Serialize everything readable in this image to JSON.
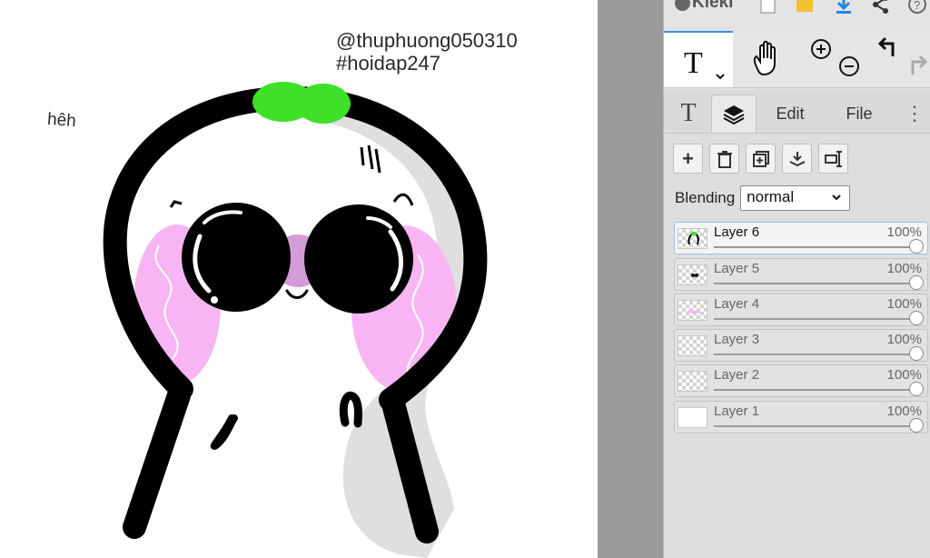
{
  "app": {
    "name": "Kleki"
  },
  "canvas": {
    "text_handle": "@thuphuong050310",
    "text_tag": "#hoidap247",
    "text_left": "hêh"
  },
  "tools": {
    "active_tool": "text-tool",
    "hand_tool": "hand-tool"
  },
  "tabs": [
    {
      "id": "text",
      "label": ""
    },
    {
      "id": "layers",
      "label": ""
    },
    {
      "id": "edit",
      "label": "Edit"
    },
    {
      "id": "file",
      "label": "File"
    }
  ],
  "blending": {
    "label": "Blending",
    "value": "normal"
  },
  "layers": [
    {
      "name": "Layer 6",
      "opacity": "100%",
      "active": true
    },
    {
      "name": "Layer 5",
      "opacity": "100%",
      "active": false
    },
    {
      "name": "Layer 4",
      "opacity": "100%",
      "active": false
    },
    {
      "name": "Layer 3",
      "opacity": "100%",
      "active": false
    },
    {
      "name": "Layer 2",
      "opacity": "100%",
      "active": false
    },
    {
      "name": "Layer 1",
      "opacity": "100%",
      "active": false
    }
  ],
  "colors": {
    "accent": "#3a8fe8",
    "sprout": "#3ee02a",
    "blush": "#f8b8f4",
    "download": "#1e88e5",
    "folder": "#f2c230"
  }
}
